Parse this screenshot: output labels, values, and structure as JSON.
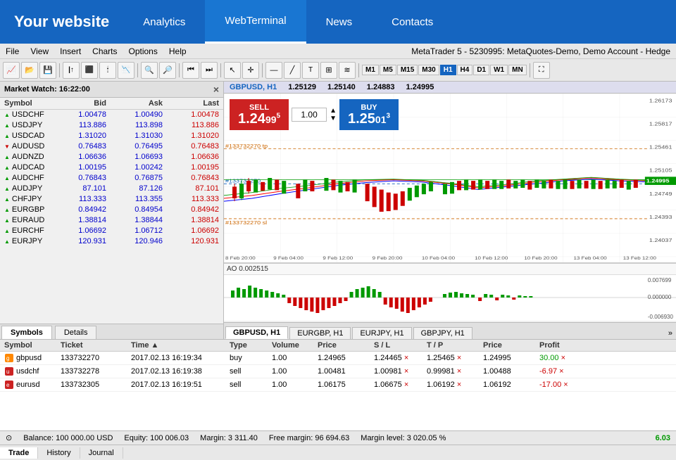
{
  "nav": {
    "site_title": "Your website",
    "items": [
      {
        "label": "Analytics",
        "active": false
      },
      {
        "label": "WebTerminal",
        "active": true
      },
      {
        "label": "News",
        "active": false
      },
      {
        "label": "Contacts",
        "active": false
      }
    ]
  },
  "menu": {
    "items": [
      "File",
      "View",
      "Insert",
      "Charts",
      "Options",
      "Help"
    ]
  },
  "meta": {
    "info": "MetaTrader 5 - 5230995: MetaQuotes-Demo, Demo Account - Hedge"
  },
  "toolbar": {
    "timeframes": [
      "M1",
      "M5",
      "M15",
      "M30",
      "H1",
      "H4",
      "D1",
      "W1",
      "MN"
    ],
    "active_tf": "H1"
  },
  "market_watch": {
    "title": "Market Watch: 16:22:00",
    "columns": [
      "Symbol",
      "Bid",
      "Ask",
      "Last"
    ],
    "rows": [
      {
        "sym": "USDCHF",
        "arrow": "up",
        "bid": "1.00478",
        "ask": "1.00490",
        "last": "1.00478"
      },
      {
        "sym": "USDJPY",
        "arrow": "up",
        "bid": "113.886",
        "ask": "113.898",
        "last": "113.886"
      },
      {
        "sym": "USDCAD",
        "arrow": "up",
        "bid": "1.31020",
        "ask": "1.31030",
        "last": "1.31020"
      },
      {
        "sym": "AUDUSD",
        "arrow": "down",
        "bid": "0.76483",
        "ask": "0.76495",
        "last": "0.76483"
      },
      {
        "sym": "AUDNZD",
        "arrow": "up",
        "bid": "1.06636",
        "ask": "1.06693",
        "last": "1.06636"
      },
      {
        "sym": "AUDCAD",
        "arrow": "up",
        "bid": "1.00195",
        "ask": "1.00242",
        "last": "1.00195"
      },
      {
        "sym": "AUDCHF",
        "arrow": "up",
        "bid": "0.76843",
        "ask": "0.76875",
        "last": "0.76843"
      },
      {
        "sym": "AUDJPY",
        "arrow": "up",
        "bid": "87.101",
        "ask": "87.126",
        "last": "87.101"
      },
      {
        "sym": "CHFJPY",
        "arrow": "up",
        "bid": "113.333",
        "ask": "113.355",
        "last": "113.333"
      },
      {
        "sym": "EURGBP",
        "arrow": "up",
        "bid": "0.84942",
        "ask": "0.84954",
        "last": "0.84942"
      },
      {
        "sym": "EURAUD",
        "arrow": "up",
        "bid": "1.38814",
        "ask": "1.38844",
        "last": "1.38814"
      },
      {
        "sym": "EURCHF",
        "arrow": "up",
        "bid": "1.06692",
        "ask": "1.06712",
        "last": "1.06692"
      },
      {
        "sym": "EURJPY",
        "arrow": "up",
        "bid": "120.931",
        "ask": "120.946",
        "last": "120.931"
      }
    ]
  },
  "mw_tabs": [
    "Symbols",
    "Details"
  ],
  "instrument": {
    "name": "GBPUSD, H1",
    "bid": "1.25129",
    "ask": "1.25140",
    "last": "1.24883",
    "price": "1.24995"
  },
  "order_widget": {
    "sell_label": "SELL",
    "sell_price_int": "1.24",
    "sell_price_frac": "99",
    "sell_superscript": "5",
    "qty": "1.00",
    "buy_label": "BUY",
    "buy_price_int": "1.25",
    "buy_price_frac": "01",
    "buy_superscript": "3"
  },
  "chart_annotations": {
    "tp_label": "#133732270 tp",
    "sl_label": "#133732270 sl",
    "order_label": "#133732270"
  },
  "chart_tabs": [
    {
      "label": "GBPUSD, H1",
      "active": true
    },
    {
      "label": "EURGBP, H1",
      "active": false
    },
    {
      "label": "EURJPY, H1",
      "active": false
    },
    {
      "label": "GBPJPY, H1",
      "active": false
    }
  ],
  "chart_x_labels": [
    "8 Feb 20:00",
    "9 Feb 04:00",
    "9 Feb 12:00",
    "9 Feb 20:00",
    "10 Feb 04:00",
    "10 Feb 12:00",
    "10 Feb 20:00",
    "13 Feb 04:00",
    "13 Feb 12:00"
  ],
  "chart_y_labels": [
    "1.26173",
    "1.25817",
    "1.25461",
    "1.25105",
    "1.24749",
    "1.24393",
    "1.24037"
  ],
  "osc_label": "AO 0.002515",
  "osc_y_labels": [
    "0.007699",
    "0.000000",
    "-0.006930"
  ],
  "positions": {
    "headers": [
      "Symbol",
      "Ticket",
      "Time",
      "Type",
      "Volume",
      "Price",
      "S / L",
      "T / P",
      "Price",
      "Profit"
    ],
    "rows": [
      {
        "sym": "gbpusd",
        "ticket": "133732270",
        "time": "2017.02.13 16:19:34",
        "type": "buy",
        "vol": "1.00",
        "price": "1.24965",
        "sl": "1.24465",
        "tp": "1.25465",
        "cur_price": "1.24995",
        "profit": "30.00"
      },
      {
        "sym": "usdchf",
        "ticket": "133732278",
        "time": "2017.02.13 16:19:38",
        "type": "sell",
        "vol": "1.00",
        "price": "1.00481",
        "sl": "1.00981",
        "tp": "0.99981",
        "cur_price": "1.00488",
        "profit": "-6.97"
      },
      {
        "sym": "eurusd",
        "ticket": "133732305",
        "time": "2017.02.13 16:19:51",
        "type": "sell",
        "vol": "1.00",
        "price": "1.06175",
        "sl": "1.06675",
        "tp": "1.06192",
        "cur_price": "1.06192",
        "profit": "-17.00"
      }
    ]
  },
  "balance_bar": {
    "balance": "Balance: 100 000.00 USD",
    "equity": "Equity: 100 006.03",
    "margin": "Margin: 3 311.40",
    "free_margin": "Free margin: 96 694.63",
    "margin_level": "Margin level: 3 020.05 %",
    "profit": "6.03"
  },
  "bottom_tabs": [
    "Trade",
    "History",
    "Journal"
  ]
}
